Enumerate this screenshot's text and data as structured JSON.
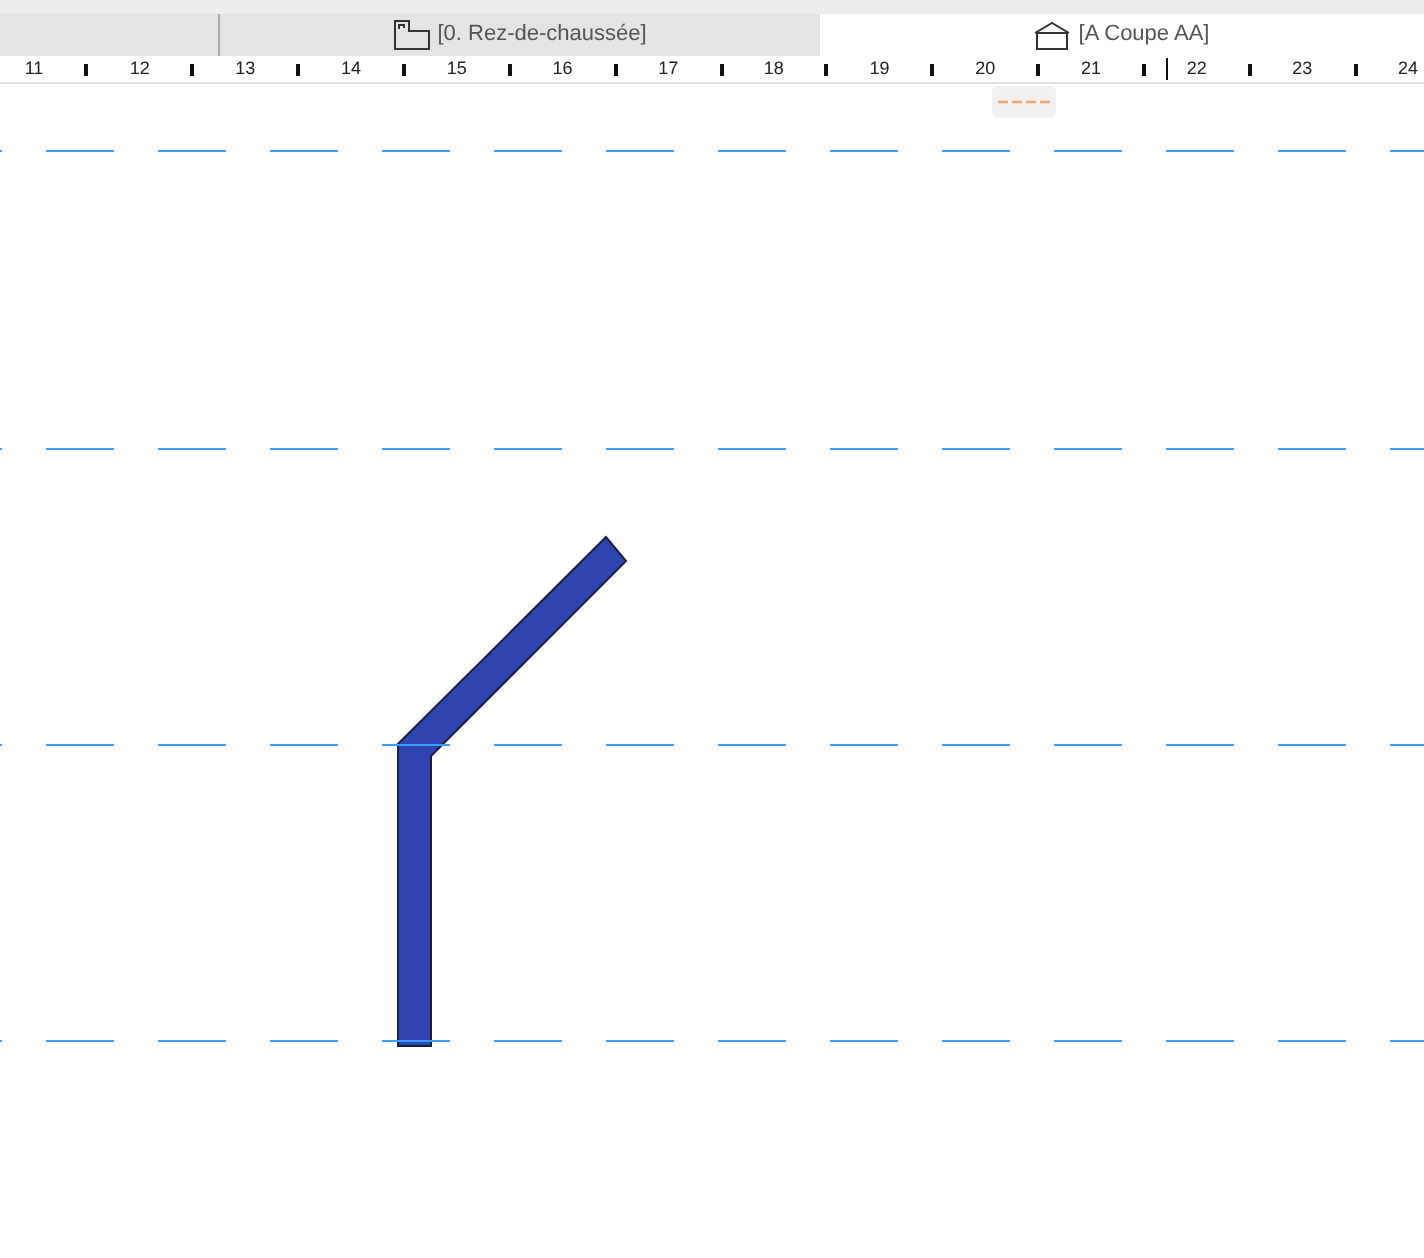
{
  "tabs": [
    {
      "label": "[0. Rez-de-chaussée]",
      "kind": "floor-plan",
      "selected": false
    },
    {
      "label": "[A Coupe AA]",
      "kind": "section",
      "selected": true
    }
  ],
  "ruler": {
    "labels": [
      "11",
      "12",
      "13",
      "14",
      "15",
      "16",
      "17",
      "18",
      "19",
      "20",
      "21",
      "22",
      "23",
      "24"
    ]
  }
}
